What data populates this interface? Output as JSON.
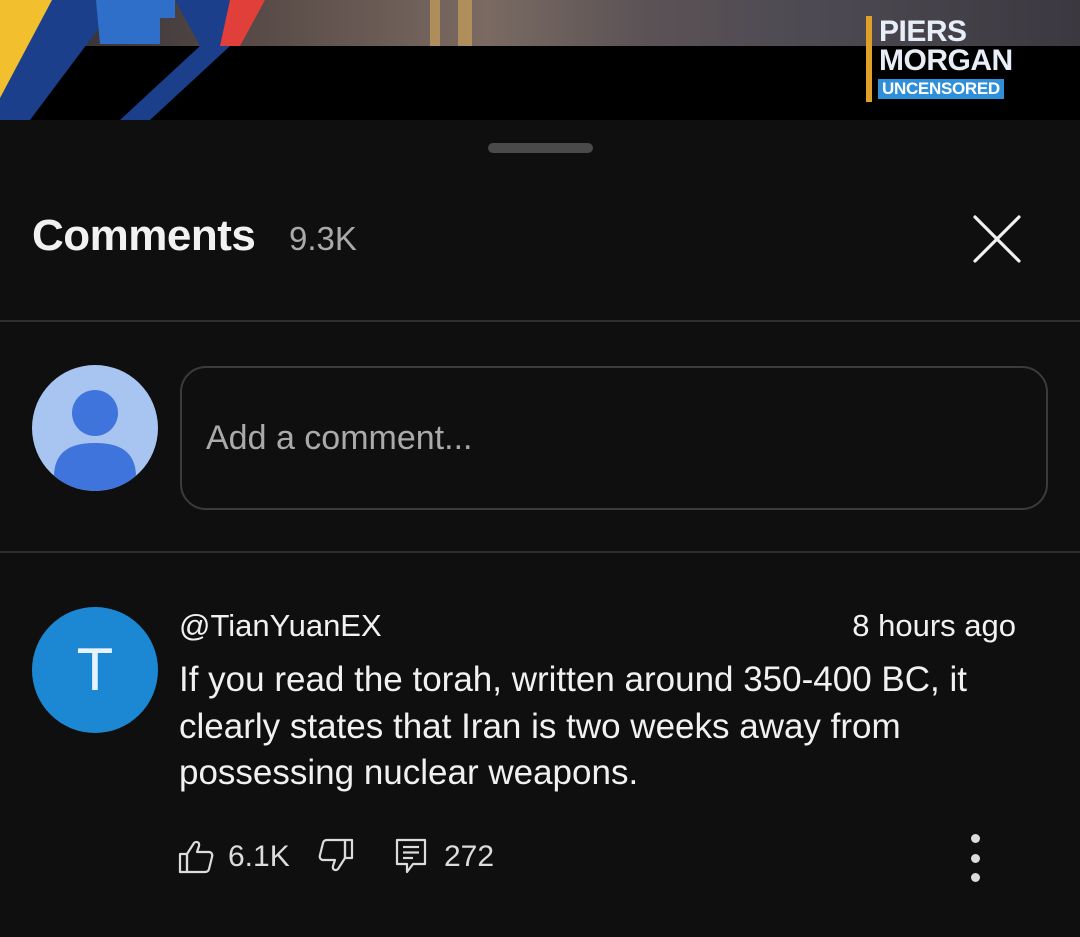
{
  "video": {
    "logo_line1": "PIERS",
    "logo_line2": "MORGAN",
    "logo_line3": "UNCENSORED"
  },
  "comments_panel": {
    "title": "Comments",
    "count": "9.3K",
    "close_icon": "close-icon"
  },
  "composer": {
    "placeholder": "Add a comment...",
    "value": "",
    "avatar_icon": "person-icon"
  },
  "comment": {
    "avatar_letter": "T",
    "author": "@TianYuanEX",
    "time": "8 hours ago",
    "text": "If you read the torah, written around 350-400 BC, it clearly states that Iran is two weeks away from possessing nuclear weapons.",
    "likes": "6.1K",
    "replies": "272",
    "icons": [
      "thumb-up-icon",
      "thumb-down-icon",
      "reply-icon",
      "more-vert-icon"
    ]
  },
  "colors": {
    "background": "#0f0f0f",
    "text_primary": "#f1f1f1",
    "text_secondary": "#aaaaaa",
    "divider": "#2e2e2e",
    "comment_avatar": "#1c88d4",
    "composer_avatar": "#a8c4f0",
    "composer_avatar_figure": "#3f74dc",
    "logo_accent": "#2f8fd8"
  }
}
